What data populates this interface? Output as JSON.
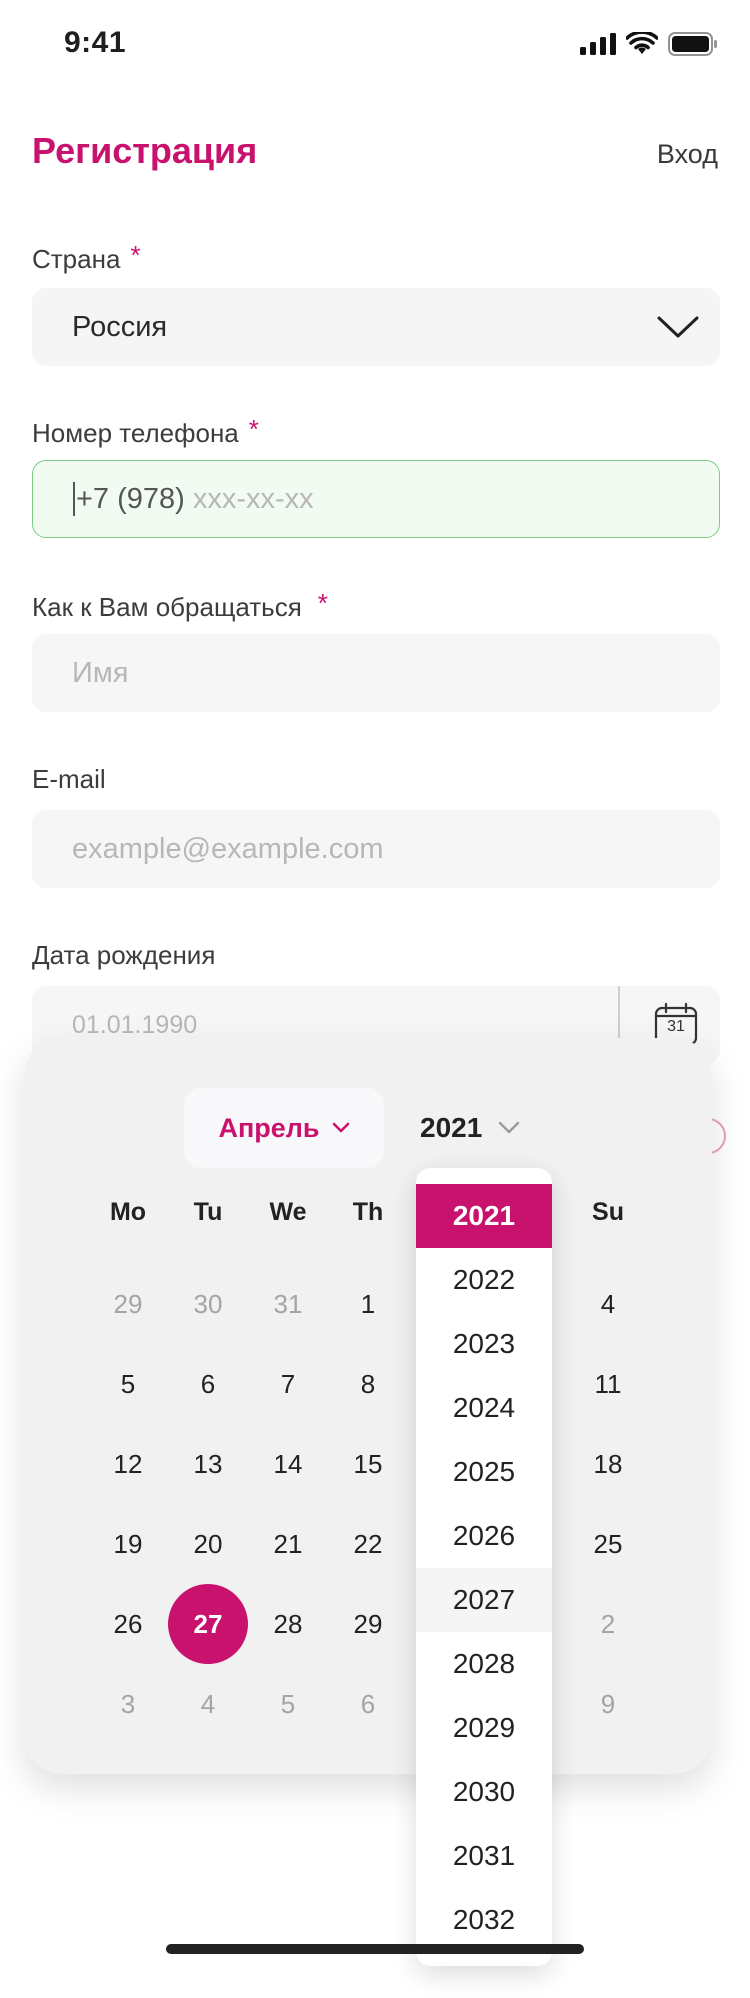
{
  "status_bar": {
    "time": "9:41"
  },
  "header": {
    "title": "Регистрация",
    "login_link": "Вход"
  },
  "form": {
    "country": {
      "label": "Страна",
      "required": "*",
      "value": "Россия"
    },
    "phone": {
      "label": "Номер телефона",
      "required": "*",
      "prefix": "+7 (978)",
      "placeholder": "xxx-xx-xx"
    },
    "name": {
      "label": "Как к Вам обращаться",
      "required": "*",
      "placeholder": "Имя"
    },
    "email": {
      "label": "E-mail",
      "placeholder": "example@example.com"
    },
    "birthdate": {
      "label": "Дата рождения",
      "placeholder": "01.01.1990",
      "calendar_icon_text": "31"
    }
  },
  "calendar": {
    "month": "Апрель",
    "year": "2021",
    "weekdays": [
      "Mo",
      "Tu",
      "We",
      "Th",
      "",
      "",
      "Su"
    ],
    "weeks": [
      [
        {
          "d": "29",
          "m": true
        },
        {
          "d": "30",
          "m": true
        },
        {
          "d": "31",
          "m": true
        },
        {
          "d": "1"
        },
        null,
        null,
        {
          "d": "4"
        }
      ],
      [
        {
          "d": "5"
        },
        {
          "d": "6"
        },
        {
          "d": "7"
        },
        {
          "d": "8"
        },
        null,
        null,
        {
          "d": "11"
        }
      ],
      [
        {
          "d": "12"
        },
        {
          "d": "13"
        },
        {
          "d": "14"
        },
        {
          "d": "15"
        },
        null,
        null,
        {
          "d": "18"
        }
      ],
      [
        {
          "d": "19"
        },
        {
          "d": "20"
        },
        {
          "d": "21"
        },
        {
          "d": "22"
        },
        null,
        null,
        {
          "d": "25"
        }
      ],
      [
        {
          "d": "26"
        },
        {
          "d": "27",
          "s": true
        },
        {
          "d": "28"
        },
        {
          "d": "29"
        },
        null,
        null,
        {
          "d": "2",
          "m": true
        }
      ],
      [
        {
          "d": "3",
          "m": true
        },
        {
          "d": "4",
          "m": true
        },
        {
          "d": "5",
          "m": true
        },
        {
          "d": "6",
          "m": true
        },
        null,
        null,
        {
          "d": "9",
          "m": true
        }
      ]
    ],
    "year_options": [
      "2021",
      "2022",
      "2023",
      "2024",
      "2025",
      "2026",
      "2027",
      "2028",
      "2029",
      "2030",
      "2031",
      "2032"
    ],
    "selected_year": "2021",
    "hovered_year": "2027"
  },
  "colors": {
    "accent": "#c9126d",
    "success_border": "#7ccc84"
  }
}
